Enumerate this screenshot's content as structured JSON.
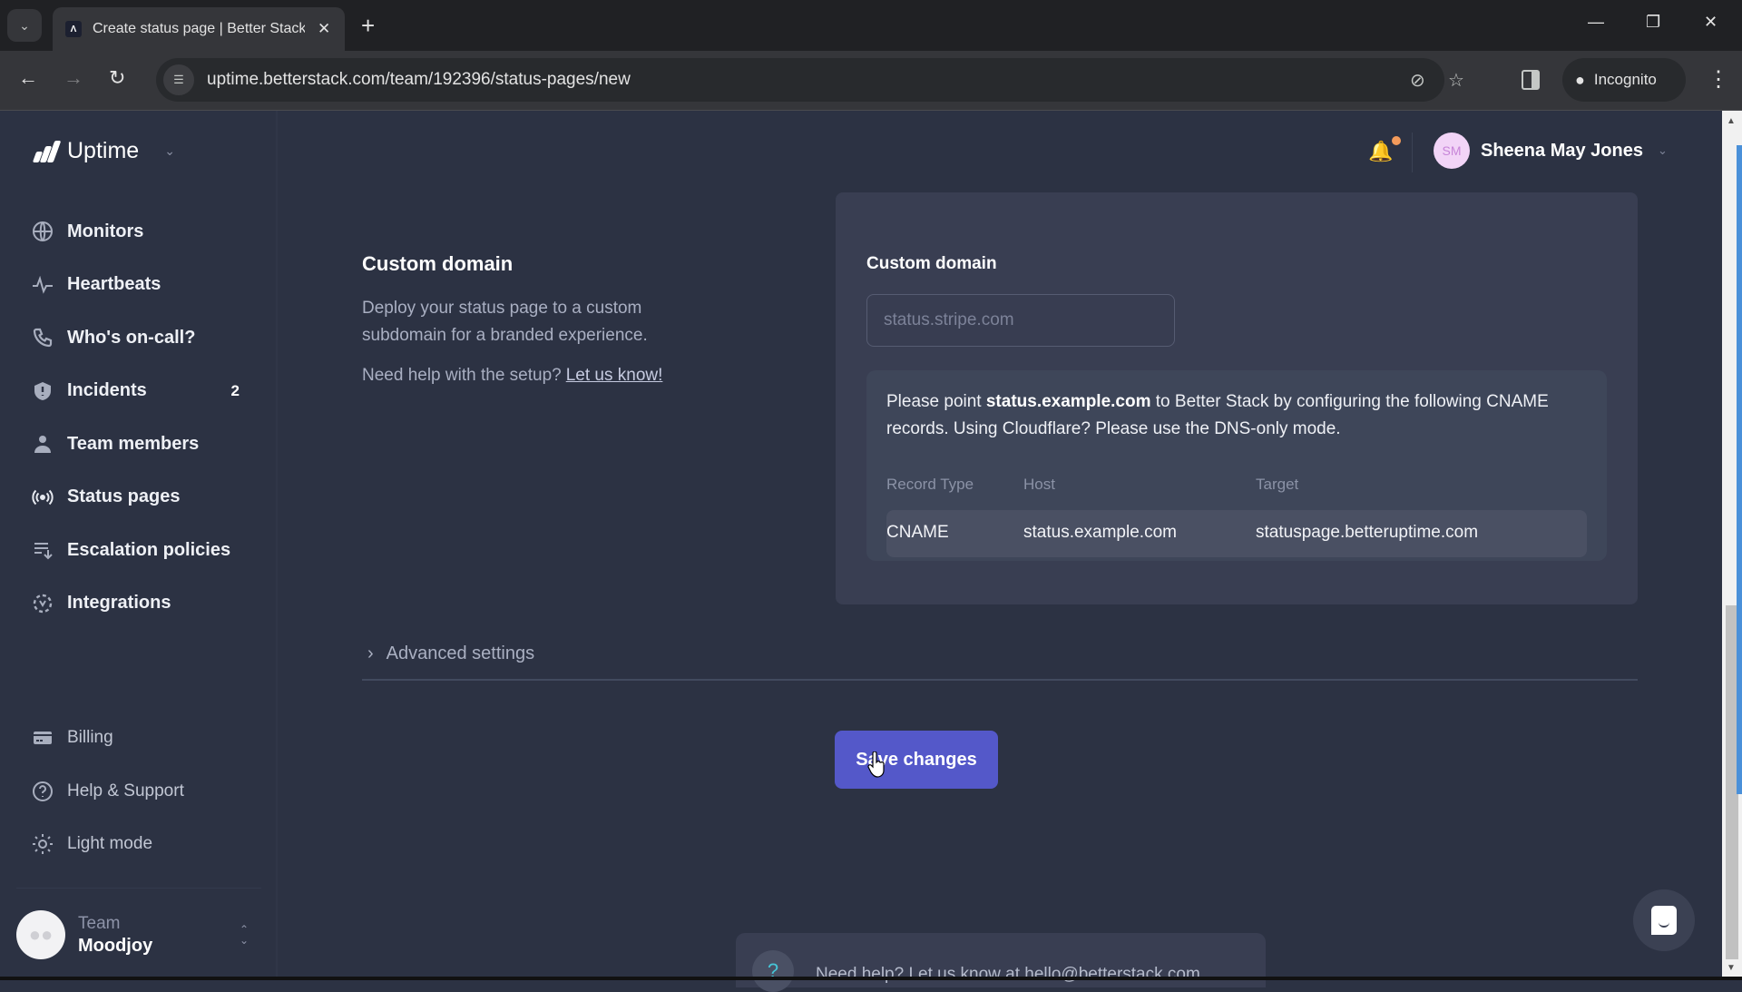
{
  "browser": {
    "tab_title": "Create status page | Better Stack",
    "url": "uptime.betterstack.com/team/192396/status-pages/new",
    "incognito_label": "Incognito",
    "icons": {
      "tab_search": "chevron-down-icon",
      "favicon": "betterstack-logo-icon",
      "back": "arrow-left-icon",
      "forward": "arrow-right-icon",
      "reload": "reload-icon",
      "site_info": "tune-icon",
      "eye_off": "eye-off-icon",
      "bookmark": "star-icon",
      "side_panel": "side-panel-icon",
      "incognito": "incognito-icon",
      "menu": "kebab-menu-icon"
    }
  },
  "app": {
    "product_name": "Uptime",
    "user": {
      "initials": "SM",
      "name": "Sheena May Jones",
      "has_notification": true
    },
    "sidebar": {
      "items": [
        {
          "label": "Monitors",
          "icon": "globe-icon"
        },
        {
          "label": "Heartbeats",
          "icon": "heartbeat-icon"
        },
        {
          "label": "Who's on-call?",
          "icon": "phone-icon"
        },
        {
          "label": "Incidents",
          "icon": "shield-alert-icon",
          "badge": "2"
        },
        {
          "label": "Team members",
          "icon": "user-icon"
        },
        {
          "label": "Status pages",
          "icon": "broadcast-icon"
        },
        {
          "label": "Escalation policies",
          "icon": "list-arrow-icon"
        },
        {
          "label": "Integrations",
          "icon": "integrations-icon"
        }
      ],
      "bottom_items": [
        {
          "label": "Billing",
          "icon": "credit-card-icon"
        },
        {
          "label": "Help & Support",
          "icon": "help-circle-icon"
        },
        {
          "label": "Light mode",
          "icon": "sun-icon"
        }
      ],
      "team": {
        "label": "Team",
        "name": "Moodjoy"
      }
    }
  },
  "main": {
    "section": {
      "title": "Custom domain",
      "description": "Deploy your status page to a custom subdomain for a branded experience.",
      "help_prefix": "Need help with the setup?",
      "help_link": "Let us know!"
    },
    "form": {
      "field_label": "Custom domain",
      "field_value": "",
      "field_placeholder": "status.stripe.com",
      "dns_text_before": "Please point",
      "dns_domain": "status.example.com",
      "dns_text_after": "to Better Stack by configuring the following CNAME records. Using Cloudflare? Please use the DNS-only mode.",
      "table": {
        "headers": [
          "Record Type",
          "Host",
          "Target"
        ],
        "rows": [
          [
            "CNAME",
            "status.example.com",
            "statuspage.betteruptime.com"
          ]
        ]
      }
    },
    "advanced_settings_label": "Advanced settings",
    "save_button_label": "Save changes",
    "help_banner": "Need help? Let us know at hello@betterstack.com",
    "colors": {
      "primary": "#5458c9",
      "notification": "#f49b5b",
      "background": "#2c3243",
      "card": "#393e52"
    }
  }
}
